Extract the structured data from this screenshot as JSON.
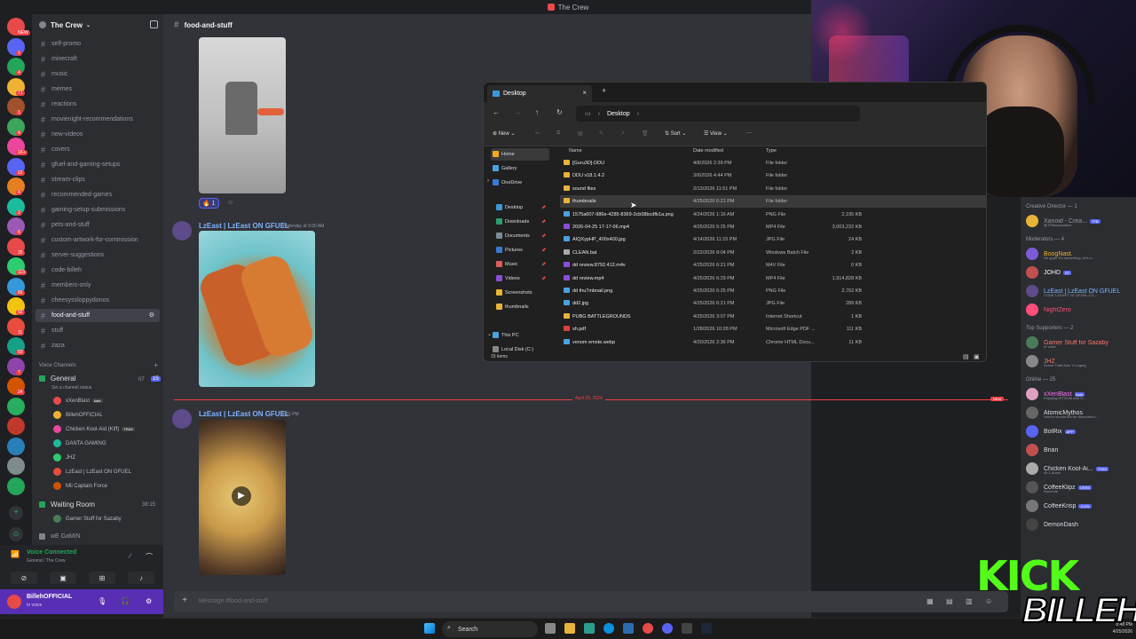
{
  "window": {
    "title": "The Crew"
  },
  "guild": {
    "name": "The Crew"
  },
  "server_badges": [
    "NEW",
    "1",
    "4",
    "71",
    "1",
    "4",
    "1K+",
    "22",
    "4",
    "2",
    "6",
    "35",
    "113",
    "86",
    "92",
    "11",
    "59",
    "7",
    "24"
  ],
  "channels": [
    "self-promo",
    "minecraft",
    "music",
    "memes",
    "reactions",
    "movienight-recommendations",
    "new-videos",
    "covers",
    "gfuel-and-gaming-setups",
    "stream-clips",
    "recommended-games",
    "gaming-setup-submissions",
    "pets-and-stuff",
    "custom-artwork-for-commission",
    "server-suggestions",
    "code-billeh",
    "members-only",
    "cheesyssloppydonos",
    "food-and-stuff",
    "stuff",
    "zaza"
  ],
  "active_channel": "food-and-stuff",
  "voice": {
    "category": "Voice Channels",
    "general": {
      "name": "General",
      "count": "07",
      "limit": "15",
      "status": "Set a channel status"
    },
    "users": [
      {
        "name": "xXenBlast",
        "tag": "kate"
      },
      {
        "name": "BillehOFFICIAL",
        "tag": ""
      },
      {
        "name": "Chicken Kool-Aid (Kiff)",
        "tag": "TRAX"
      },
      {
        "name": "DANTA GAMING",
        "tag": ""
      },
      {
        "name": "JHZ",
        "tag": ""
      },
      {
        "name": "LzEast | LzEast ON GFUEL",
        "tag": ""
      },
      {
        "name": "Mii Captain Force",
        "tag": ""
      }
    ],
    "waiting": {
      "name": "Waiting Room",
      "count": "38:15",
      "user": "Gamer Stuff for Sazaby"
    },
    "wegamin": "wE GaMiN"
  },
  "voice_panel": {
    "title": "Voice Connected",
    "sub": "General / The Crew"
  },
  "user_panel": {
    "name": "BillehOFFICIAL",
    "status": "In voice"
  },
  "chat": {
    "channel": "food-and-stuff",
    "reaction": {
      "emoji": "🔥",
      "count": "1"
    },
    "messages": [
      {
        "author": "LzEast | LzEast ON GFUEL",
        "time": "Yesterday at 9:30 AM"
      },
      {
        "author": "LzEast | LzEast ON GFUEL",
        "time": "6:01 PM"
      }
    ],
    "divider_date": "April 25, 2026",
    "new_label": "NEW",
    "composer_placeholder": "Message #food-and-stuff"
  },
  "explorer": {
    "tab_title": "Desktop",
    "breadcrumb": "Desktop",
    "cmd": {
      "new": "New",
      "sort": "Sort",
      "view": "View",
      "more": "···"
    },
    "nav": [
      {
        "label": "Home",
        "color": "#f5a623"
      },
      {
        "label": "Gallery",
        "color": "#4aa3df"
      },
      {
        "label": "OneDrive",
        "color": "#3a7bd5"
      },
      {
        "label": "Desktop",
        "color": "#3a9ad9"
      },
      {
        "label": "Downloads",
        "color": "#2f9e6e"
      },
      {
        "label": "Documents",
        "color": "#7c8a99"
      },
      {
        "label": "Pictures",
        "color": "#3a7bd5"
      },
      {
        "label": "Music",
        "color": "#e05a5a"
      },
      {
        "label": "Videos",
        "color": "#8a4fd6"
      },
      {
        "label": "Screenshots",
        "color": "#e8b339"
      },
      {
        "label": "thumbnails",
        "color": "#e8b339"
      },
      {
        "label": "This PC",
        "color": "#4aa3df"
      },
      {
        "label": "Local Disk (C:)",
        "color": "#888888"
      }
    ],
    "columns": {
      "name": "Name",
      "date": "Date modified",
      "type": "Type",
      "size": ""
    },
    "files": [
      {
        "name": "[Guru3D]-DDU",
        "date": "4/8/2026 2:39 PM",
        "type": "File folder",
        "size": "",
        "color": "#e8b339"
      },
      {
        "name": "DDU v18.1.4.2",
        "date": "3/6/2026 4:44 PM",
        "type": "File folder",
        "size": "",
        "color": "#e8b339"
      },
      {
        "name": "sound files",
        "date": "2/13/2026 11:51 PM",
        "type": "File folder",
        "size": "",
        "color": "#e8b339"
      },
      {
        "name": "thumbnails",
        "date": "4/25/2026 6:21 PM",
        "type": "File folder",
        "size": "",
        "color": "#e8b339"
      },
      {
        "name": "1575a607-986e-4285-8369-2cb08bcdfb1a.png",
        "date": "4/24/2026 1:16 AM",
        "type": "PNG File",
        "size": "2,195 KB",
        "color": "#4aa3df"
      },
      {
        "name": "2026-04-25 17-17-06.mp4",
        "date": "4/25/2026 5:25 PM",
        "type": "MP4 File",
        "size": "3,003,232 KB",
        "color": "#8a4fd6"
      },
      {
        "name": "AIQXypHP_400x400.jpg",
        "date": "4/14/2026 11:15 PM",
        "type": "JPG File",
        "size": "24 KB",
        "color": "#4aa3df"
      },
      {
        "name": "CLEAN.bat",
        "date": "2/22/2026 8:04 PM",
        "type": "Windows Batch File",
        "size": "2 KB",
        "color": "#aaaaaa"
      },
      {
        "name": "dd review.8792.412.m4v",
        "date": "4/25/2026 6:21 PM",
        "type": "M4V File",
        "size": "0 KB",
        "color": "#8a4fd6"
      },
      {
        "name": "dd review.mp4",
        "date": "4/25/2026 6:29 PM",
        "type": "MP4 File",
        "size": "1,914,828 KB",
        "color": "#8a4fd6"
      },
      {
        "name": "dd thu7mbnail.png",
        "date": "4/25/2026 6:25 PM",
        "type": "PNG File",
        "size": "2,702 KB",
        "color": "#4aa3df"
      },
      {
        "name": "dd2.jpg",
        "date": "4/25/2026 6:21 PM",
        "type": "JPG File",
        "size": "289 KB",
        "color": "#4aa3df"
      },
      {
        "name": "PUBG BATTLEGROUNDS",
        "date": "4/25/2026 3:07 PM",
        "type": "Internet Shortcut",
        "size": "1 KB",
        "color": "#e8b339"
      },
      {
        "name": "sh.pdf",
        "date": "1/28/2026 10:28 PM",
        "type": "Microsoft Edge PDF ...",
        "size": "111 KB",
        "color": "#d9443a"
      },
      {
        "name": "venom emote.webp",
        "date": "4/20/2026 2:36 PM",
        "type": "Chrome HTML Docu...",
        "size": "11 KB",
        "color": "#4aa3df"
      }
    ],
    "highlighted_index": 3,
    "status": "15 items"
  },
  "members": {
    "groups": [
      {
        "label": "Creative Director — 1",
        "members": [
          {
            "name": "Xanoid - Crea...",
            "tag": "TFB",
            "status": "@TFBassociation",
            "color": "#e8b339",
            "name_color": "#949ba4"
          }
        ]
      },
      {
        "label": "Moderators — 4",
        "members": [
          {
            "name": "BoogNast.",
            "tag": "",
            "status": "Ok guys. It's something, let's o...",
            "color": "#7b5bd6",
            "name_color": "#f0b232"
          },
          {
            "name": "JOHD",
            "tag": "RT",
            "status": "",
            "color": "#c0504d",
            "name_color": "#f2f3f5"
          },
          {
            "name": "LzEast | LzEast ON GFUEL",
            "tag": "",
            "status": "CODE 'LZEAST' AT GFUEL.CO...",
            "color": "#5e4b8b",
            "name_color": "#7fb3ff"
          },
          {
            "name": "NightZero",
            "tag": "",
            "status": "",
            "color": "#ff4d7a",
            "name_color": "#ff4d7a"
          }
        ]
      },
      {
        "label": "Top Supporters — 2",
        "members": [
          {
            "name": "Gamer Stuff for Sazaby",
            "tag": "",
            "status": "In voice",
            "color": "#4a7c59",
            "name_color": "#f47b67"
          },
          {
            "name": "JHZ",
            "tag": "",
            "status": "Grand Theft Auto V Legacy",
            "color": "#888888",
            "name_color": "#f47b67"
          }
        ]
      },
      {
        "label": "Online — 25",
        "members": [
          {
            "name": "xXenBlast",
            "tag": "kate",
            "status": "Enjoying HIT2K26 and V...",
            "color": "#e0a0c0",
            "name_color": "#ff73fa"
          },
          {
            "name": "AtomicMythos",
            "tag": "",
            "status": "Humor should not be dissected b...",
            "color": "#666666",
            "name_color": "#dbdee1"
          },
          {
            "name": "BotRix",
            "tag": "APP",
            "status": "",
            "color": "#5865f2",
            "name_color": "#dbdee1"
          },
          {
            "name": "Brian",
            "tag": "",
            "status": "",
            "color": "#c0504d",
            "name_color": "#dbdee1"
          },
          {
            "name": "Chicken Kool-Ai...",
            "tag": "TRAX",
            "status": "4h 1 Alone",
            "color": "#aaaaaa",
            "name_color": "#dbdee1"
          },
          {
            "name": "CoffeeKlipz",
            "tag": "OSRS",
            "status": "RuneLite",
            "color": "#555555",
            "name_color": "#dbdee1"
          },
          {
            "name": "CoffeeKrisp",
            "tag": "CURL",
            "status": "",
            "color": "#777777",
            "name_color": "#dbdee1"
          },
          {
            "name": "DemonDash",
            "tag": "",
            "status": "",
            "color": "#444444",
            "name_color": "#dbdee1"
          }
        ]
      }
    ]
  },
  "taskbar": {
    "search": "Search",
    "time": "8:48 PM",
    "date": "4/25/2026"
  },
  "overlay": {
    "kick": "KICK",
    "brand": "BILLEH"
  },
  "colors": {
    "accent": "#5865f2",
    "online": "#23a55a",
    "kick_green": "#53fc18",
    "danger": "#f23f43"
  }
}
